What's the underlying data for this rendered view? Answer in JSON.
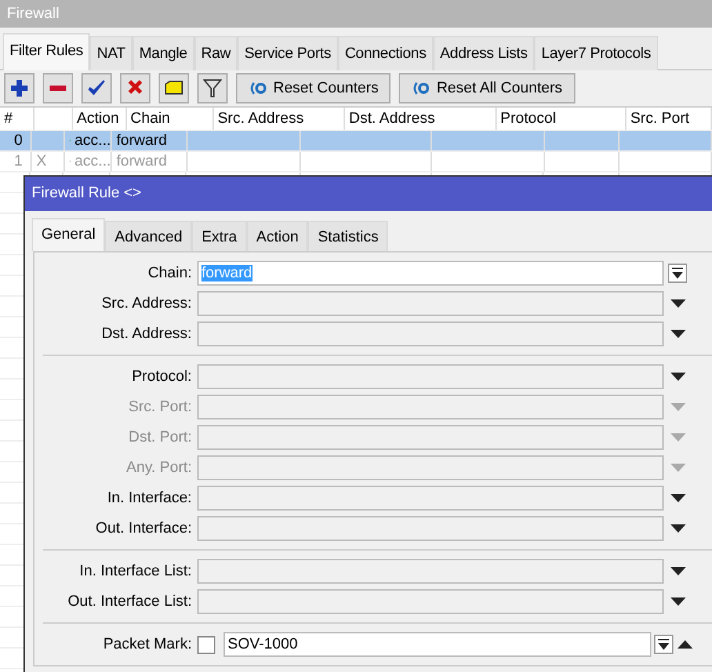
{
  "window": {
    "title": "Firewall"
  },
  "tabs": [
    {
      "label": "Filter Rules",
      "selected": true
    },
    {
      "label": "NAT",
      "selected": false
    },
    {
      "label": "Mangle",
      "selected": false
    },
    {
      "label": "Raw",
      "selected": false
    },
    {
      "label": "Service Ports",
      "selected": false
    },
    {
      "label": "Connections",
      "selected": false
    },
    {
      "label": "Address Lists",
      "selected": false
    },
    {
      "label": "Layer7 Protocols",
      "selected": false
    }
  ],
  "toolbar": {
    "buttons": [
      "Reset Counters",
      "Reset All Counters"
    ]
  },
  "table": {
    "columns": [
      "#",
      "Action",
      "Chain",
      "Src. Address",
      "Dst. Address",
      "Protocol",
      "Src. Port"
    ],
    "rows": [
      {
        "number": "0",
        "action": "acc...",
        "chain": "forward",
        "selected": true,
        "disabled": false
      },
      {
        "number": "1",
        "flag": "X",
        "action": "acc...",
        "chain": "forward",
        "selected": false,
        "disabled": true
      }
    ]
  },
  "dialog": {
    "title": "Firewall Rule <>",
    "tabs": [
      {
        "label": "General",
        "selected": true
      },
      {
        "label": "Advanced",
        "selected": false
      },
      {
        "label": "Extra",
        "selected": false
      },
      {
        "label": "Action",
        "selected": false
      },
      {
        "label": "Statistics",
        "selected": false
      }
    ],
    "sections": [
      [
        {
          "label": "Chain:",
          "kind": "combo",
          "value": "forward",
          "value_selected": true
        },
        {
          "label": "Src. Address:",
          "kind": "dropdown",
          "disabled": false
        },
        {
          "label": "Dst. Address:",
          "kind": "dropdown",
          "disabled": false
        }
      ],
      [
        {
          "label": "Protocol:",
          "kind": "dropdown",
          "disabled": false
        },
        {
          "label": "Src. Port:",
          "kind": "dropdown",
          "disabled": true
        },
        {
          "label": "Dst. Port:",
          "kind": "dropdown",
          "disabled": true
        },
        {
          "label": "Any. Port:",
          "kind": "dropdown",
          "disabled": true
        },
        {
          "label": "In. Interface:",
          "kind": "dropdown",
          "disabled": false
        },
        {
          "label": "Out. Interface:",
          "kind": "dropdown",
          "disabled": false
        }
      ],
      [
        {
          "label": "In. Interface List:",
          "kind": "dropdown",
          "disabled": false
        },
        {
          "label": "Out. Interface List:",
          "kind": "dropdown",
          "disabled": false
        }
      ],
      [
        {
          "label": "Packet Mark:",
          "kind": "mark",
          "checked": false,
          "value": "SOV-1000"
        }
      ]
    ]
  }
}
